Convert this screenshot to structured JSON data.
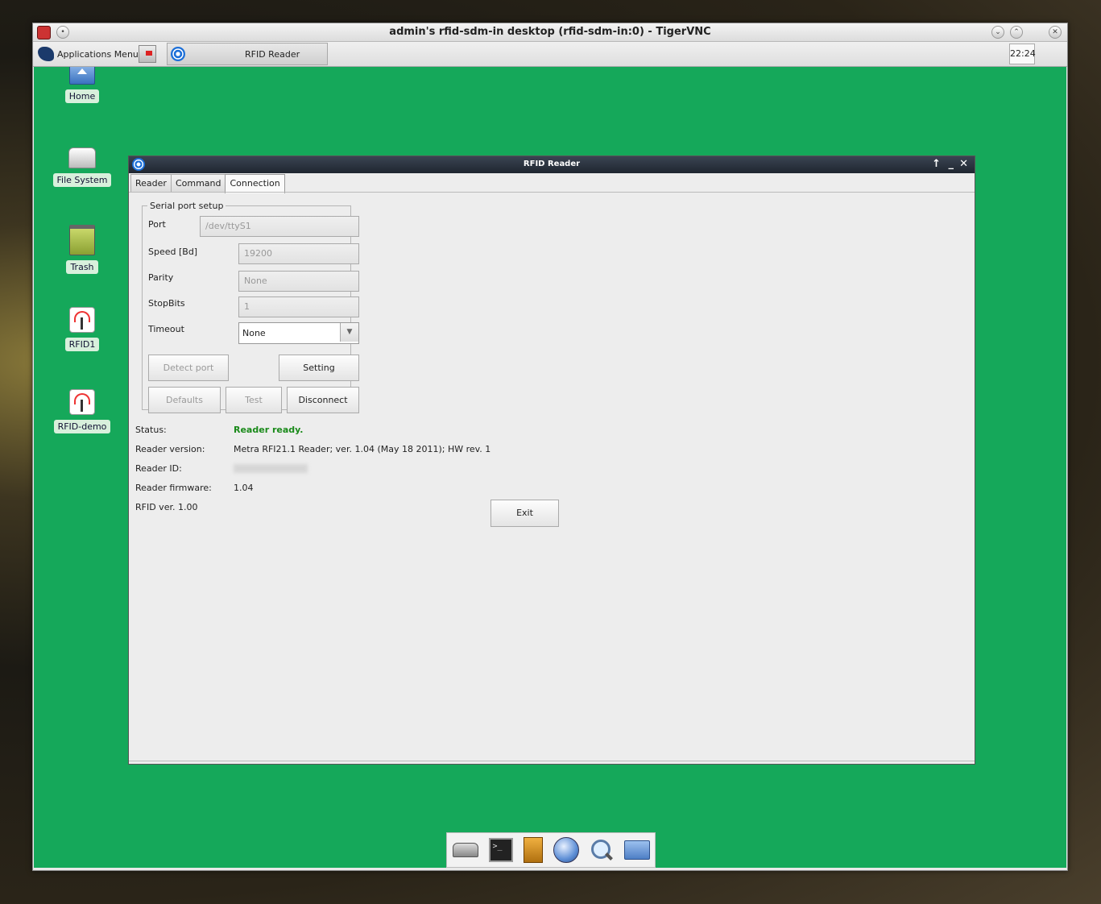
{
  "vnc": {
    "title": "admin's rfid-sdm-in desktop (rfid-sdm-in:0) - TigerVNC"
  },
  "panel": {
    "app_menu": "Applications Menu",
    "task_label": "RFID Reader",
    "clock": "22:24"
  },
  "desktop_icons": [
    {
      "label": "Home",
      "icon": "home-icon"
    },
    {
      "label": "File System",
      "icon": "drive-icon"
    },
    {
      "label": "Trash",
      "icon": "trash-icon"
    },
    {
      "label": "RFID1",
      "icon": "antenna-icon"
    },
    {
      "label": "RFID-demo",
      "icon": "antenna-icon"
    }
  ],
  "app": {
    "title": "RFID Reader",
    "tabs": [
      "Reader",
      "Command",
      "Connection"
    ],
    "active_tab": "Connection",
    "serial": {
      "legend": "Serial port setup",
      "port_label": "Port",
      "port_value": "/dev/ttyS1",
      "speed_label": "Speed [Bd]",
      "speed_value": "19200",
      "parity_label": "Parity",
      "parity_value": "None",
      "stopbits_label": "StopBits",
      "stopbits_value": "1",
      "timeout_label": "Timeout",
      "timeout_value": "None"
    },
    "buttons": {
      "detect": "Detect port",
      "setting": "Setting",
      "defaults": "Defaults",
      "test": "Test",
      "disconnect": "Disconnect",
      "exit": "Exit"
    },
    "info": {
      "status_label": "Status:",
      "status_value": "Reader ready.",
      "version_label": "Reader version:",
      "version_value": "Metra RFI21.1 Reader; ver. 1.04 (May 18 2011); HW rev. 1",
      "id_label": "Reader ID:",
      "firmware_label": "Reader firmware:",
      "firmware_value": "1.04",
      "rfid_ver": "RFID ver. 1.00"
    },
    "colors": {
      "status_ok": "#1a8a1a",
      "desktop_bg": "#15a85a"
    }
  },
  "dock": [
    "drive-icon",
    "terminal-icon",
    "file-cabinet-icon",
    "globe-icon",
    "search-icon",
    "folder-icon"
  ]
}
